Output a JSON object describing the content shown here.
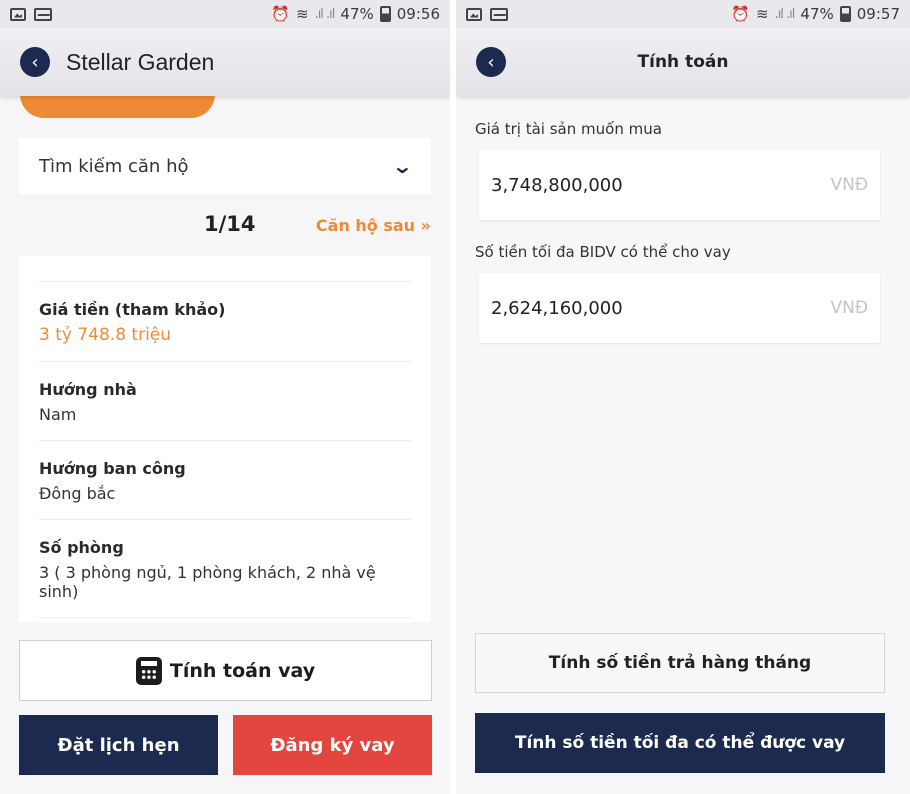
{
  "colors": {
    "navy": "#1c2a4f",
    "orange": "#ef8a34",
    "red": "#e2463f"
  },
  "left": {
    "status": {
      "signal_text": ".ıl .ıl",
      "battery": "47%",
      "time": "09:56"
    },
    "header": {
      "title": "Stellar Garden",
      "back_icon": "chevron-left-icon"
    },
    "dropdown": {
      "label": "Tìm kiếm căn hộ",
      "icon": "chevron-down-icon"
    },
    "pager": {
      "current": "1/14",
      "next_label": "Căn hộ sau"
    },
    "details": [
      {
        "label": "Giá tiền (tham khảo)",
        "value": "3 tỷ 748.8 triệu"
      },
      {
        "label": "Hướng nhà",
        "value": "Nam"
      },
      {
        "label": "Hướng ban công",
        "value": "Đông bắc"
      },
      {
        "label": "Số phòng",
        "value": "3 ( 3 phòng ngủ, 1 phòng khách, 2 nhà vệ sinh)"
      }
    ],
    "buttons": {
      "calculate_loan": "Tính toán vay",
      "book_appointment": "Đặt lịch hẹn",
      "register_loan": "Đăng ký vay"
    }
  },
  "right": {
    "status": {
      "signal_text": ".ıl .ıl",
      "battery": "47%",
      "time": "09:57"
    },
    "header": {
      "title": "Tính toán",
      "back_icon": "chevron-left-icon"
    },
    "fields": [
      {
        "label": "Giá trị tài sản muốn mua",
        "value": "3,748,800,000",
        "unit": "VNĐ"
      },
      {
        "label": "Số tiền tối đa BIDV có thể cho vay",
        "value": "2,624,160,000",
        "unit": "VNĐ"
      }
    ],
    "buttons": {
      "monthly_payment": "Tính số tiền trả hàng tháng",
      "max_loan": "Tính số tiền tối đa có thể được vay"
    }
  }
}
